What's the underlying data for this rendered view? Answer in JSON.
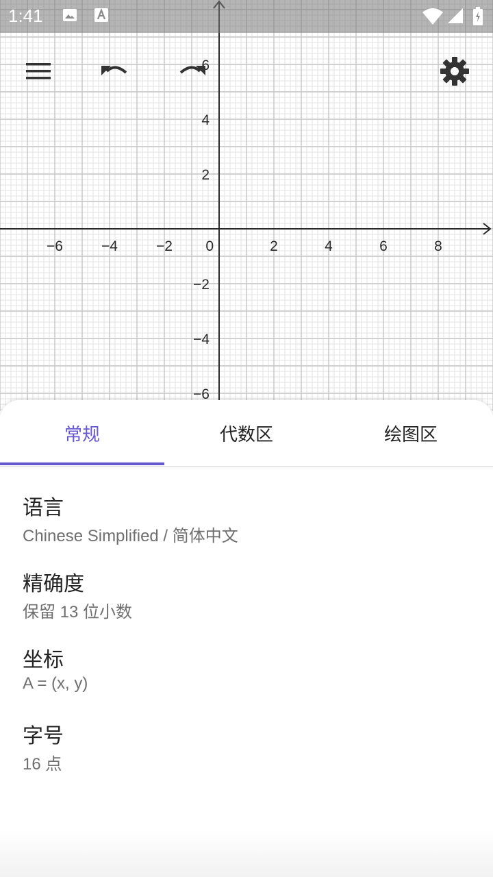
{
  "status_bar": {
    "time": "1:41",
    "icons": [
      "image-icon",
      "text-a-icon",
      "wifi-icon",
      "signal-icon",
      "battery-icon"
    ]
  },
  "toolbar": {
    "icons": [
      "menu-icon",
      "undo-icon",
      "redo-icon",
      "settings-icon"
    ]
  },
  "graph": {
    "x_ticks": [
      "−6",
      "−4",
      "−2",
      "0",
      "2",
      "4",
      "6",
      "8"
    ],
    "y_ticks": [
      "6",
      "4",
      "2",
      "−2",
      "−4",
      "−6"
    ]
  },
  "tabs": [
    {
      "label": "常规",
      "active": true
    },
    {
      "label": "代数区",
      "active": false
    },
    {
      "label": "绘图区",
      "active": false
    }
  ],
  "settings": [
    {
      "title": "语言",
      "value": "Chinese Simplified / 简体中文"
    },
    {
      "title": "精确度",
      "value": "保留 13 位小数"
    },
    {
      "title": "坐标",
      "value": "A = (x, y)"
    },
    {
      "title": "字号",
      "value": "16 点"
    }
  ],
  "colors": {
    "accent": "#6557d2",
    "grid_minor": "#e3e3e3",
    "grid_major": "#c4c4c4",
    "axis": "#2a2a2a"
  }
}
